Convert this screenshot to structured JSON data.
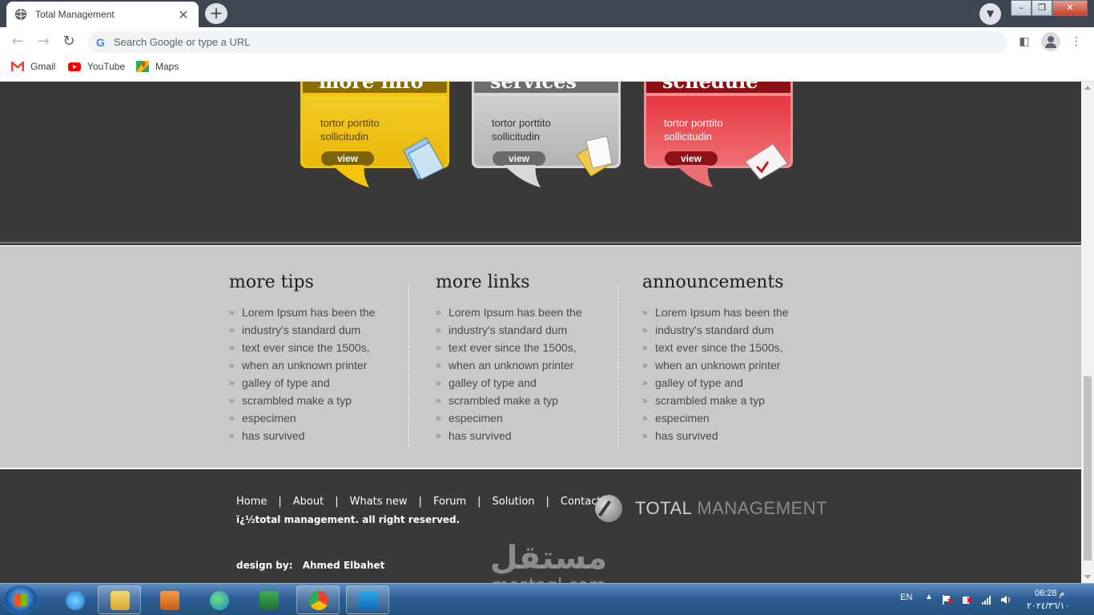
{
  "browser": {
    "tab_title": "Total Management",
    "tab_close": "✕",
    "new_tab": "+",
    "omnibox_placeholder": "Search Google or type a URL",
    "bookmarks": [
      "Gmail",
      "YouTube",
      "Maps"
    ]
  },
  "feature_boxes": [
    {
      "heading": "more info",
      "text": "tortor porttito sollicitudin",
      "button": "view",
      "color": "#f5c50b"
    },
    {
      "heading": "services",
      "text": "tortor porttito sollicitudin",
      "button": "view",
      "color": "#bdbdbd"
    },
    {
      "heading": "schedule",
      "text": "tortor porttito sollicitudin",
      "button": "view",
      "color": "#e9545a"
    }
  ],
  "columns": [
    {
      "title": "more tips",
      "items": [
        "Lorem Ipsum has been the",
        "industry's standard dum",
        "text ever since the 1500s,",
        "when an unknown printer",
        "galley of type and",
        "scrambled make a typ",
        "especimen",
        "has survived"
      ]
    },
    {
      "title": "more links",
      "items": [
        "Lorem Ipsum has been the",
        "industry's standard dum",
        "text ever since the 1500s,",
        "when an unknown printer",
        "galley of type and",
        "scrambled make a typ",
        "especimen",
        "has survived"
      ]
    },
    {
      "title": "announcements",
      "items": [
        "Lorem Ipsum has been the",
        "industry's standard dum",
        "text ever since the 1500s,",
        "when an unknown printer",
        "galley of type and",
        "scrambled make a typ",
        "especimen",
        "has survived"
      ]
    }
  ],
  "footer": {
    "nav": [
      "Home",
      "About",
      "Whats new",
      "Forum",
      "Solution",
      "Contact"
    ],
    "separator": "|",
    "copyright": "ï¿½total management. all right reserved.",
    "design_label": "design by:",
    "designer": "Ahmed Elbahet",
    "logo_word_1": "TOTAL",
    "logo_word_2": "MANAGEMENT"
  },
  "watermark": {
    "arabic": "مستقل",
    "latin": "mostaql.com"
  },
  "taskbar": {
    "language": "EN",
    "time": "06:28 م",
    "date": "٢٠٢٤/٣٦/١٠"
  },
  "icons": {
    "back": "arrow-left-icon",
    "forward": "arrow-right-icon",
    "reload": "reload-icon",
    "side_panel": "side-panel-icon",
    "menu": "kebab-menu-icon"
  },
  "colors": {
    "page_dark": "#3a3939",
    "page_light": "#c9c9c9",
    "yellow": "#f5c50b",
    "gray": "#bdbdbd",
    "red": "#e9545a"
  }
}
